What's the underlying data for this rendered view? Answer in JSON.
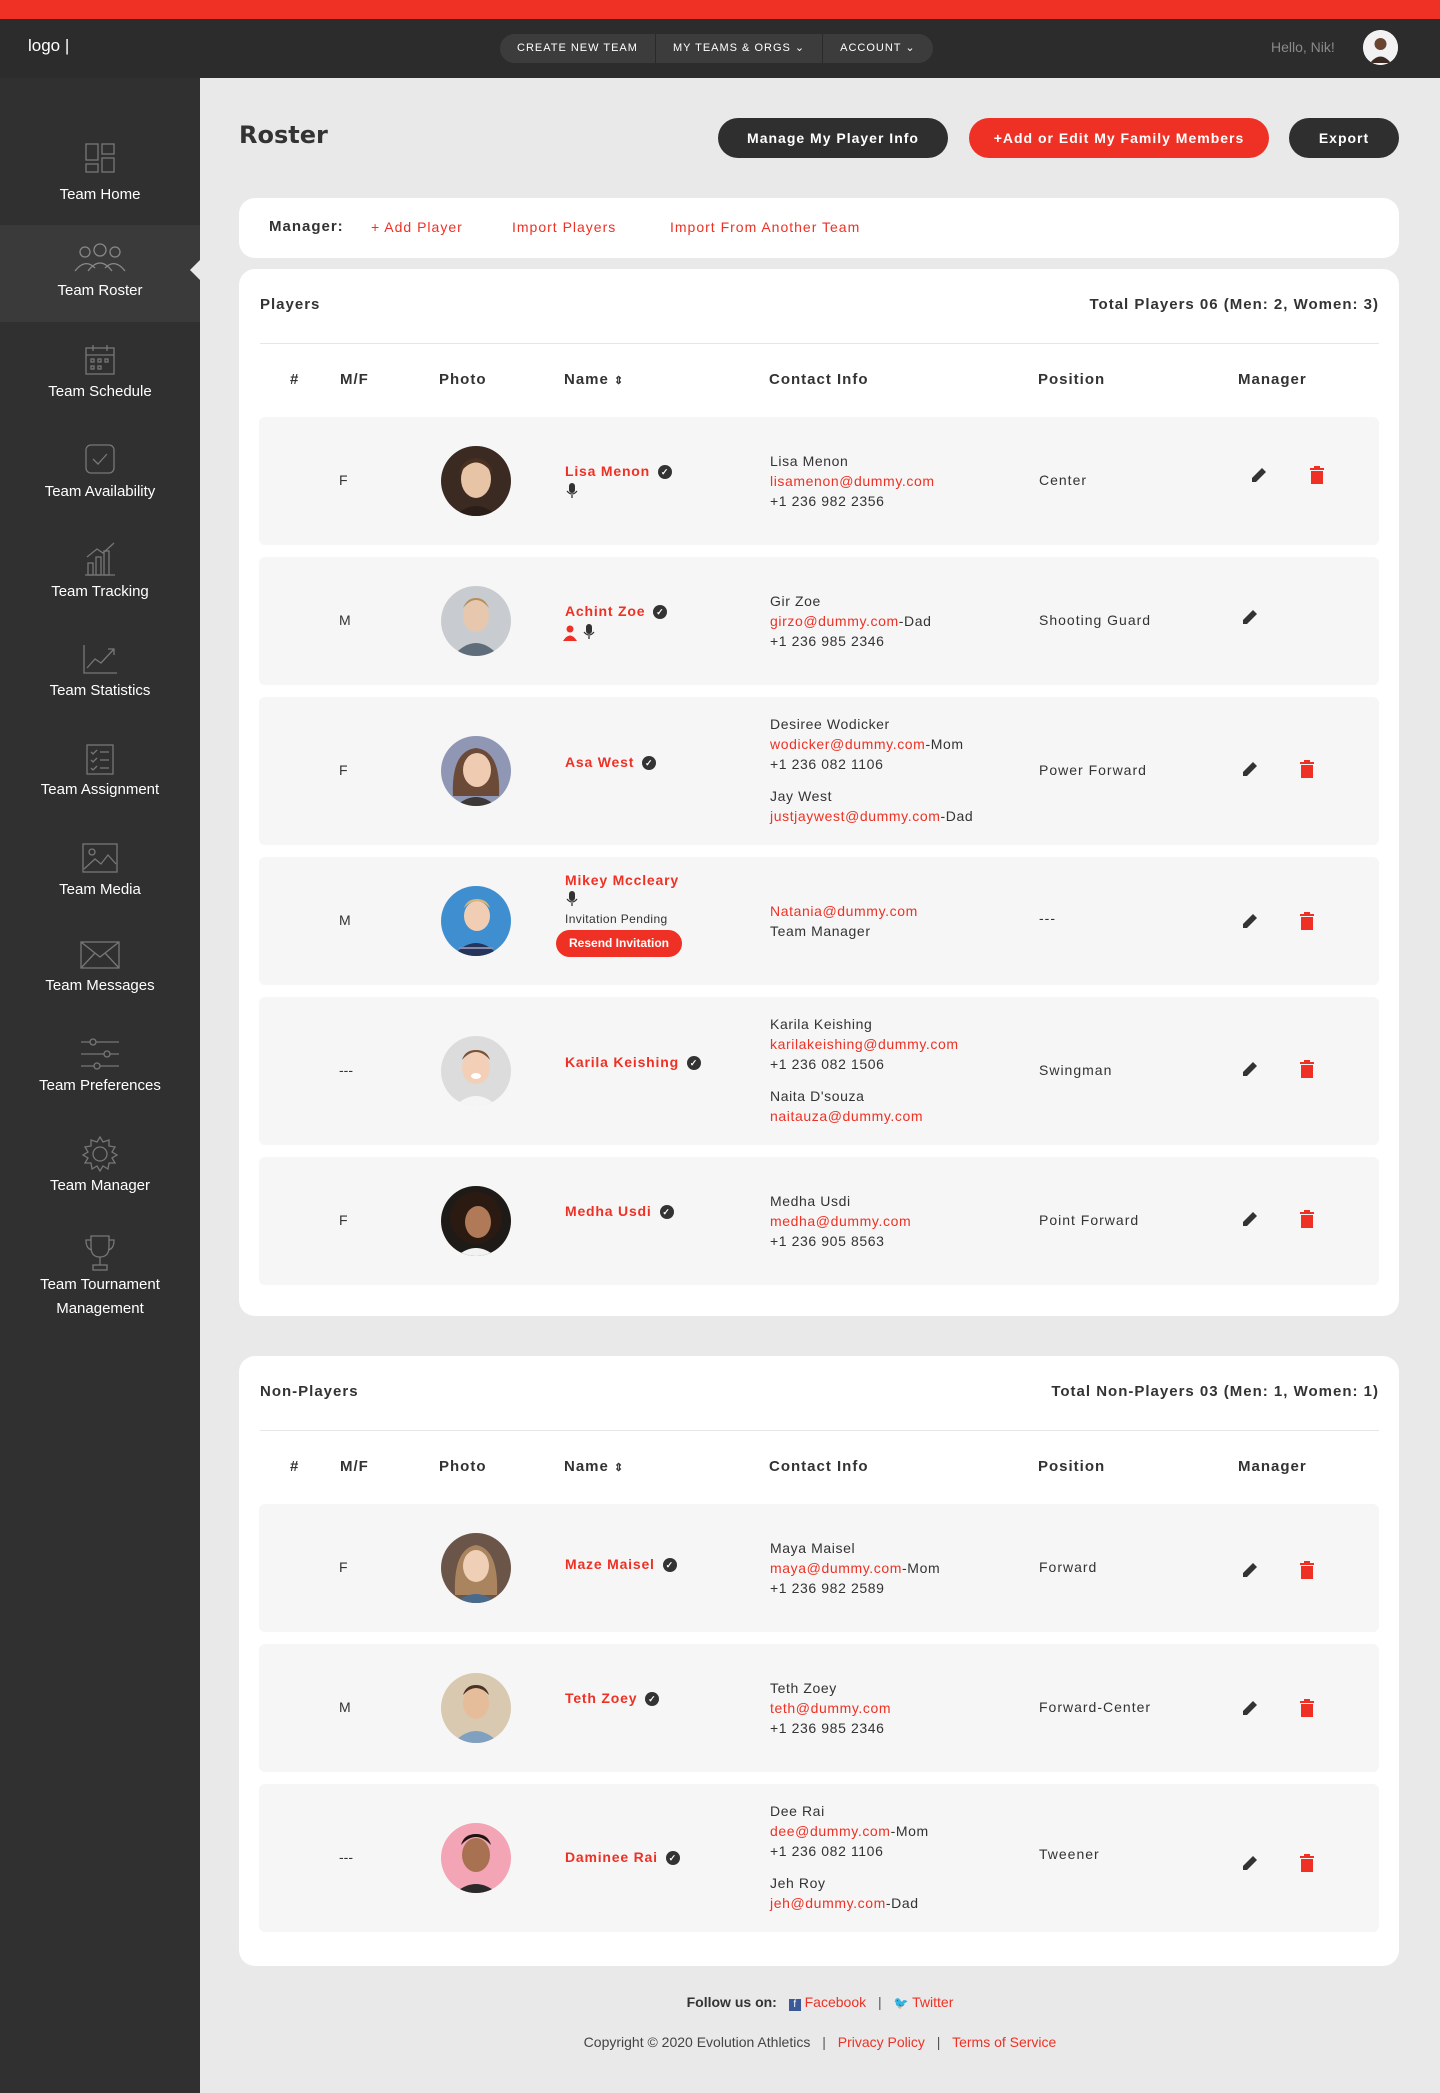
{
  "header": {
    "logo": "logo |",
    "nav": [
      "CREATE NEW TEAM",
      "MY TEAMS & ORGS",
      "ACCOUNT"
    ],
    "greeting": "Hello, Nik!"
  },
  "sidebar": {
    "items": [
      {
        "label": "Team Home",
        "icon": "dashboard-icon"
      },
      {
        "label": "Team Roster",
        "icon": "users-icon"
      },
      {
        "label": "Team Schedule",
        "icon": "calendar-icon"
      },
      {
        "label": "Team Availability",
        "icon": "checkbox-icon"
      },
      {
        "label": "Team Tracking",
        "icon": "bar-chart-icon"
      },
      {
        "label": "Team Statistics",
        "icon": "line-chart-icon"
      },
      {
        "label": "Team Assignment",
        "icon": "checklist-icon"
      },
      {
        "label": "Team Media",
        "icon": "image-icon"
      },
      {
        "label": "Team Messages",
        "icon": "envelope-icon"
      },
      {
        "label": "Team Preferences",
        "icon": "sliders-icon"
      },
      {
        "label": "Team Manager",
        "icon": "gear-icon"
      },
      {
        "label": "Team Tournament",
        "label2": "Management",
        "icon": "trophy-icon"
      }
    ],
    "active_index": 1
  },
  "page": {
    "title": "Roster",
    "buttons": {
      "manage": "Manage My Player Info",
      "family": "+Add or Edit My Family Members",
      "export": "Export"
    }
  },
  "manager_bar": {
    "label": "Manager:",
    "links": [
      "+ Add Player",
      "Import Players",
      "Import From Another Team"
    ]
  },
  "columns": [
    "#",
    "M/F",
    "Photo",
    "Name",
    "Contact Info",
    "Position",
    "Manager"
  ],
  "players": {
    "title": "Players",
    "total": "Total Players 06 (Men: 2, Women: 3)",
    "rows": [
      {
        "mf": "F",
        "name": "Lisa Menon",
        "contacts": [
          {
            "name": "Lisa Menon",
            "email": "lisamenon@dummy.com",
            "rel": "",
            "phone": "+1 236 982 2356"
          }
        ],
        "position": "Center"
      },
      {
        "mf": "M",
        "name": "Achint Zoe",
        "contacts": [
          {
            "name": "Gir Zoe",
            "email": "girzo@dummy.com",
            "rel": "-Dad",
            "phone": "+1 236 985 2346"
          }
        ],
        "position": "Shooting Guard"
      },
      {
        "mf": "F",
        "name": "Asa West",
        "contacts": [
          {
            "name": "Desiree Wodicker",
            "email": "wodicker@dummy.com",
            "rel": "-Mom",
            "phone": "+1 236 082 1106"
          },
          {
            "name": "Jay West",
            "email": "justjaywest@dummy.com",
            "rel": "-Dad",
            "phone": ""
          }
        ],
        "position": "Power Forward"
      },
      {
        "mf": "M",
        "name": "Mikey Mccleary",
        "pending": "Invitation Pending",
        "resend": "Resend Invitation",
        "contacts": [
          {
            "name": "",
            "email": "Natania@dummy.com",
            "rel": "",
            "phone": "Team Manager"
          }
        ],
        "position": "---"
      },
      {
        "mf": "---",
        "name": "Karila Keishing",
        "contacts": [
          {
            "name": "Karila Keishing",
            "email": "karilakeishing@dummy.com",
            "rel": "",
            "phone": "+1 236 082 1506"
          },
          {
            "name": "Naita D'souza",
            "email": "naitauza@dummy.com",
            "rel": "",
            "phone": ""
          }
        ],
        "position": "Swingman"
      },
      {
        "mf": "F",
        "name": "Medha Usdi",
        "contacts": [
          {
            "name": "Medha Usdi",
            "email": "medha@dummy.com",
            "rel": "",
            "phone": "+1 236 905 8563"
          }
        ],
        "position": "Point Forward"
      }
    ]
  },
  "non_players": {
    "title": "Non-Players",
    "total": "Total Non-Players 03 (Men: 1, Women: 1)",
    "rows": [
      {
        "mf": "F",
        "name": "Maze Maisel",
        "contacts": [
          {
            "name": "Maya Maisel",
            "email": "maya@dummy.com",
            "rel": "-Mom",
            "phone": "+1 236 982 2589"
          }
        ],
        "position": "Forward"
      },
      {
        "mf": "M",
        "name": "Teth Zoey",
        "contacts": [
          {
            "name": "Teth Zoey",
            "email": "teth@dummy.com",
            "rel": "",
            "phone": "+1 236 985 2346"
          }
        ],
        "position": "Forward-Center"
      },
      {
        "mf": "---",
        "name": "Daminee Rai",
        "contacts": [
          {
            "name": "Dee Rai",
            "email": "dee@dummy.com",
            "rel": "-Mom",
            "phone": "+1 236 082 1106"
          },
          {
            "name": "Jeh Roy",
            "email": "jeh@dummy.com",
            "rel": "-Dad",
            "phone": ""
          }
        ],
        "position": "Tweener"
      }
    ]
  },
  "footer": {
    "follow": "Follow us on:",
    "facebook": "Facebook",
    "twitter": "Twitter",
    "copyright": "Copyright © 2020 Evolution Athletics",
    "privacy": "Privacy Policy",
    "terms": "Terms of Service"
  },
  "colors": {
    "accent": "#ee3124",
    "dark": "#2c2c2c",
    "sidebar": "#303030"
  }
}
